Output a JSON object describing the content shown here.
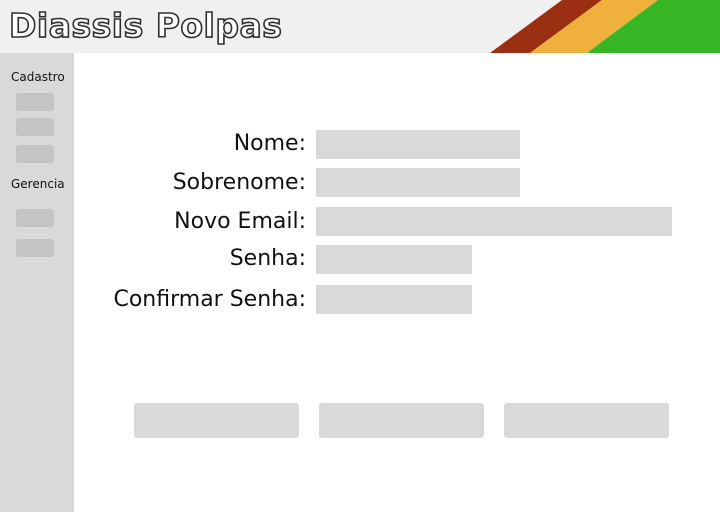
{
  "app": {
    "title": "Diassis Polpas",
    "stripe_colors": [
      "#9a2f12",
      "#f0b13c",
      "#36b624"
    ]
  },
  "sidebar": {
    "sections": [
      {
        "label": "Cadastro",
        "items": [
          "",
          "",
          ""
        ]
      },
      {
        "label": "Gerencia",
        "items": [
          "",
          ""
        ]
      }
    ]
  },
  "form": {
    "fields": [
      {
        "label": "Nome:",
        "value": ""
      },
      {
        "label": "Sobrenome:",
        "value": ""
      },
      {
        "label": "Novo Email:",
        "value": ""
      },
      {
        "label": "Senha:",
        "value": ""
      },
      {
        "label": "Confirmar Senha:",
        "value": ""
      }
    ]
  },
  "actions": {
    "buttons": [
      "",
      "",
      ""
    ]
  }
}
